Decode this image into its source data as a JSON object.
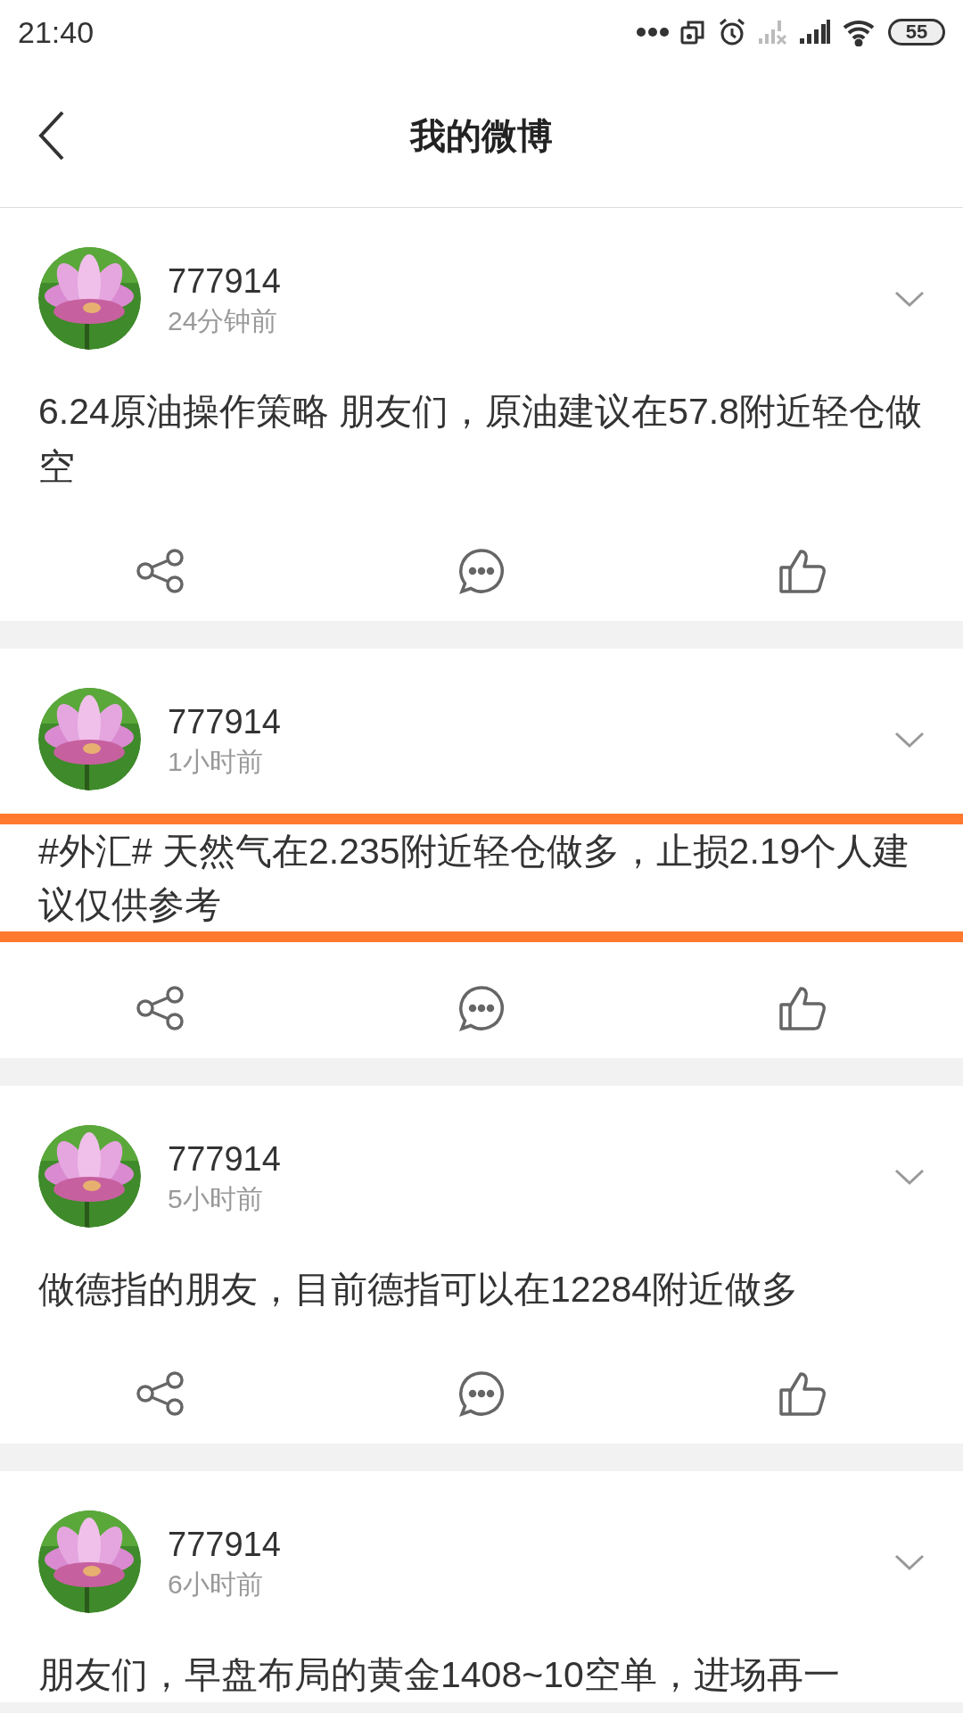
{
  "status_bar": {
    "time": "21:40",
    "battery": "55"
  },
  "header": {
    "title": "我的微博"
  },
  "posts": [
    {
      "user": "777914",
      "time": "24分钟前",
      "text": "6.24原油操作策略 朋友们，原油建议在57.8附近轻仓做空",
      "highlighted": false
    },
    {
      "user": "777914",
      "time": "1小时前",
      "text": "#外汇# 天然气在2.235附近轻仓做多，止损2.19个人建议仅供参考",
      "highlighted": true
    },
    {
      "user": "777914",
      "time": "5小时前",
      "text": "做德指的朋友，目前德指可以在12284附近做多",
      "highlighted": false
    },
    {
      "user": "777914",
      "time": "6小时前",
      "text": "朋友们，早盘布局的黄金1408~10空单，进场再一",
      "highlighted": false
    }
  ]
}
